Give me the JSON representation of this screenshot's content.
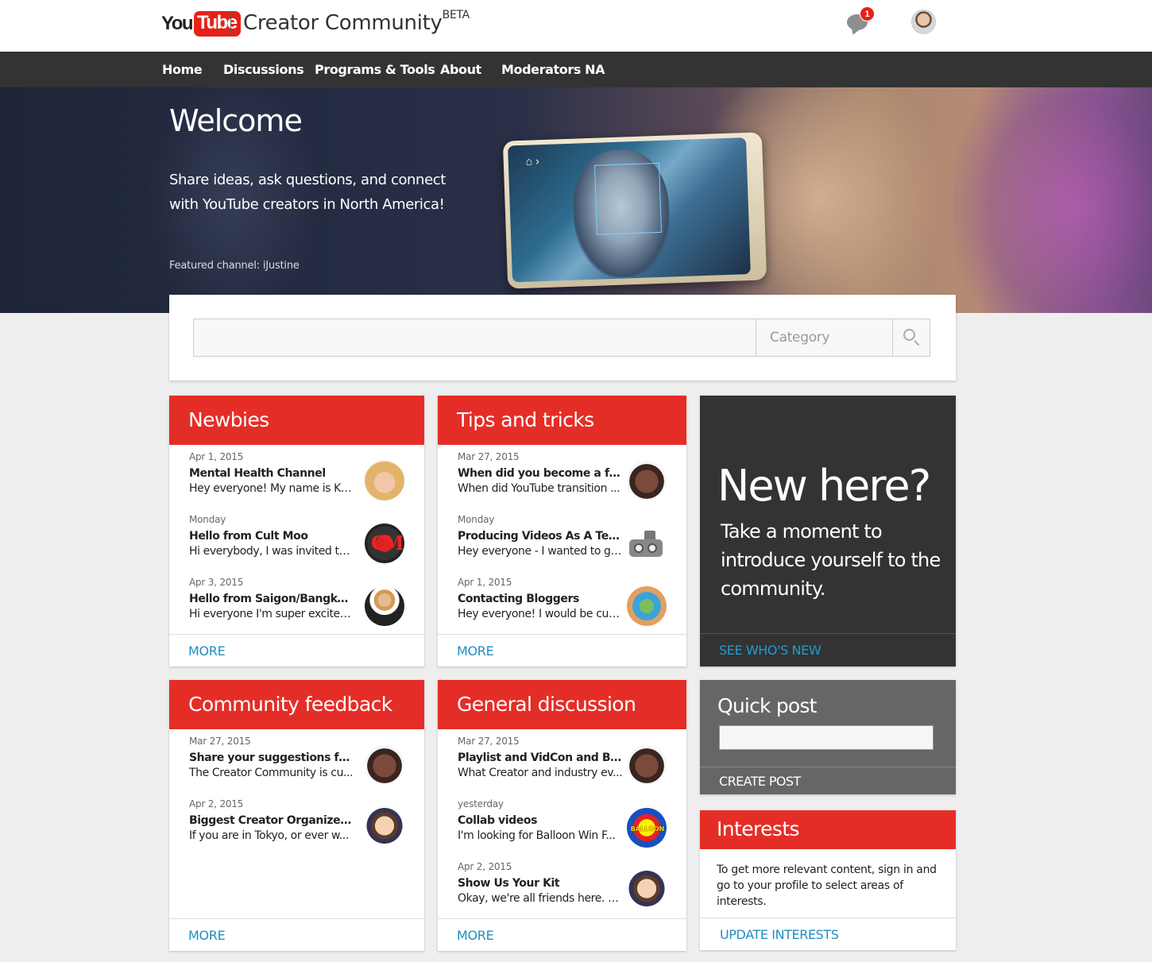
{
  "header": {
    "logo_you": "You",
    "logo_tube": "Tube",
    "site_title": "Creator Community",
    "site_badge": "BETA",
    "notification_count": "1"
  },
  "nav": {
    "items": [
      "Home",
      "Discussions",
      "Programs & Tools",
      "About",
      "Moderators NA"
    ]
  },
  "hero": {
    "title": "Welcome",
    "subtitle": "Share ideas, ask questions, and connect with YouTube creators in North America!",
    "featured": "Featured channel: iJustine"
  },
  "search": {
    "placeholder": "",
    "category": "Category"
  },
  "cards": {
    "newbies": {
      "title": "Newbies",
      "more": "MORE",
      "posts": [
        {
          "date": "Apr 1, 2015",
          "title": "Mental Health Channel",
          "snippet": "Hey everyone! My name is Ka..."
        },
        {
          "date": "Monday",
          "title": "Hello from Cult Moo",
          "snippet": "Hi everybody, I was invited to ..."
        },
        {
          "date": "Apr 3, 2015",
          "title": "Hello from Saigon/Bangkok...",
          "snippet": "Hi everyone I'm super excited..."
        }
      ]
    },
    "tips": {
      "title": "Tips and tricks",
      "more": "MORE",
      "posts": [
        {
          "date": "Mar 27, 2015",
          "title": "When did you become a full...",
          "snippet": "When did YouTube transition ..."
        },
        {
          "date": "Monday",
          "title": "Producing Videos As A Tea...",
          "snippet": "Hey everyone - I wanted to ge..."
        },
        {
          "date": "Apr 1, 2015",
          "title": "Contacting Bloggers",
          "snippet": "Hey everyone! I would be curi..."
        }
      ]
    },
    "feedback": {
      "title": "Community feedback",
      "more": "MORE",
      "posts": [
        {
          "date": "Mar 27, 2015",
          "title": "Share your suggestions for ...",
          "snippet": "The Creator Community is cu..."
        },
        {
          "date": "Apr 2, 2015",
          "title": "Biggest Creator Organized E...",
          "snippet": "If you are in Tokyo, or ever w..."
        }
      ]
    },
    "general": {
      "title": "General discussion",
      "more": "MORE",
      "posts": [
        {
          "date": "Mar 27, 2015",
          "title": "Playlist and VidCon and Buf...",
          "snippet": "What Creator and industry ev..."
        },
        {
          "date": "yesterday",
          "title": "Collab videos",
          "snippet": "I'm looking for Balloon Win F..."
        },
        {
          "date": "Apr 2, 2015",
          "title": "Show Us Your Kit",
          "snippet": "Okay, we're all friends here. L..."
        }
      ]
    }
  },
  "newhere": {
    "title": "New here?",
    "text": "Take a moment to introduce yourself to the community.",
    "link": "SEE WHO'S NEW"
  },
  "quickpost": {
    "title": "Quick post",
    "placeholder": "",
    "button": "CREATE POST"
  },
  "interests": {
    "title": "Interests",
    "text": "To get more relevant content, sign in and go to your profile to select areas of interests.",
    "link": "UPDATE INTERESTS"
  },
  "avatar_text": {
    "cult_moo": "CM",
    "balloon": "BALLOON"
  },
  "colors": {
    "accent_red": "#e52d27",
    "nav_bg": "#333333",
    "link_blue": "#1f8ec1"
  }
}
